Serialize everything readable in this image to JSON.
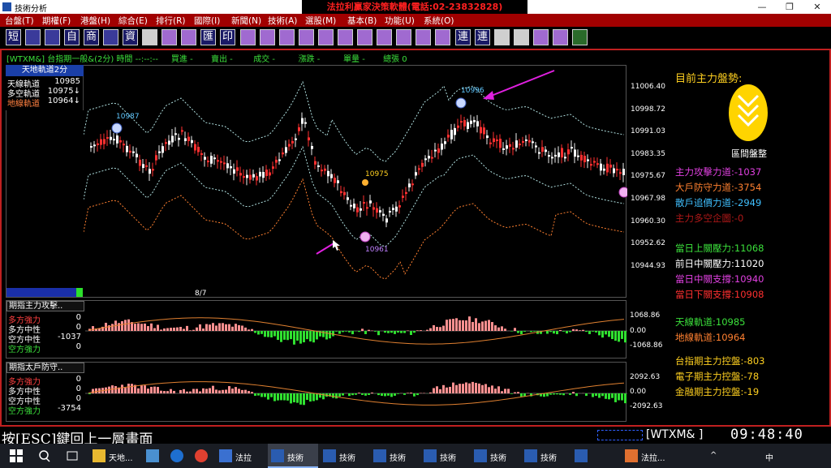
{
  "titlebar": {
    "app_title": "技術分析",
    "promo": "法拉利贏家決策軟體(電話:02-23832828)",
    "minimize": "—",
    "restore": "❐",
    "close": "✕"
  },
  "menu": [
    "台盤(T)",
    "期權(F)",
    "港盤(H)",
    "綜合(E)",
    "排行(R)",
    "國際(I)",
    "新聞(N)",
    "技術(A)",
    "選股(M)",
    "基本(B)",
    "功能(U)",
    "系統(O)"
  ],
  "toolbar": {
    "text_buttons": [
      "短",
      "自",
      "商",
      "資",
      "匯",
      "印",
      "連",
      "連"
    ]
  },
  "infobar": {
    "symbol": "[WTXM&]",
    "name": "台指期一般&(2分)",
    "time_label": "時間",
    "time_val": "--:--:--",
    "buy_label": "買進",
    "buy_val": "-",
    "sell_label": "賣出",
    "sell_val": "-",
    "deal_label": "成交",
    "deal_val": "-",
    "chg_label": "漲跌",
    "chg_val": "-",
    "vol_label": "單量",
    "vol_val": "-",
    "total_label": "總張",
    "total_val": "0"
  },
  "legend": {
    "title": "天地軌道2分",
    "rows": [
      {
        "label": "天線軌道",
        "value": "10985",
        "color": "#ffffff"
      },
      {
        "label": "多空軌道",
        "value": "10975↓",
        "color": "#ffffff"
      },
      {
        "label": "地線軌道",
        "value": "10964↓",
        "color": "#ff8040"
      }
    ]
  },
  "price_axis": [
    "11006.40",
    "10998.72",
    "10991.03",
    "10983.35",
    "10975.67",
    "10967.98",
    "10960.30",
    "10952.62",
    "10944.93"
  ],
  "markers": {
    "m1": "10987",
    "m2": "10996",
    "m3": "10975",
    "m4": "10961"
  },
  "date_label": "8/7",
  "sub1": {
    "title": "期指主力攻擊..",
    "rows": [
      {
        "label": "多方強力",
        "value": "0",
        "color": "#ff4040"
      },
      {
        "label": "多方中性",
        "value": "0",
        "color": "#ffffff"
      },
      {
        "label": "空方中性",
        "value": "-1037",
        "color": "#ffffff"
      },
      {
        "label": "空方強力",
        "value": "0",
        "color": "#3be03b"
      }
    ],
    "axis": [
      "1068.86",
      "0.00",
      "-1068.86"
    ]
  },
  "sub2": {
    "title": "期指太戶防守..",
    "rows": [
      {
        "label": "多方強力",
        "value": "0",
        "color": "#ff4040"
      },
      {
        "label": "多方中性",
        "value": "0",
        "color": "#ffffff"
      },
      {
        "label": "空方中性",
        "value": "0",
        "color": "#ffffff"
      },
      {
        "label": "空方強力",
        "value": "-3754",
        "color": "#3be03b"
      }
    ],
    "axis": [
      "2092.63",
      "0.00",
      "-2092.63"
    ]
  },
  "right_panel": {
    "title": "目前主力盤勢:",
    "badge_label": "區間盤整",
    "rows": [
      {
        "text": "主力攻擊力道:-1037",
        "color": "#e040e0"
      },
      {
        "text": "大戶防守力道:-3754",
        "color": "#ff8030"
      },
      {
        "text": "散戶追價力道:-2949",
        "color": "#40c0ff"
      },
      {
        "text": "主力多空企圖:-0",
        "color": "#b01818"
      },
      {
        "text": "當日上關壓力:11068",
        "color": "#3be03b"
      },
      {
        "text": "前日中關壓力:11020",
        "color": "#ffffff"
      },
      {
        "text": "當日中關支撐:10940",
        "color": "#e040e0"
      },
      {
        "text": "當日下關支撐:10908",
        "color": "#ff3030"
      },
      {
        "text": "天線軌道:10985",
        "color": "#3be03b"
      },
      {
        "text": "地線軌道:10964",
        "color": "#ff8030"
      },
      {
        "text": "台指期主力控盤:-803",
        "color": "#ffd020"
      },
      {
        "text": "電子期主力控盤:-78",
        "color": "#ffd020"
      },
      {
        "text": "金融期主力控盤:-19",
        "color": "#ffd020"
      }
    ]
  },
  "status": {
    "esc_text": "按[ESC]鍵回上一層畫面",
    "code": "[WTXM&  ]",
    "time": "09:48:40"
  },
  "taskbar": {
    "items": [
      "天地...",
      "法拉",
      "技術",
      "技術",
      "技術",
      "技術",
      "技術",
      "技術",
      "法拉..."
    ],
    "ime": "中"
  }
}
